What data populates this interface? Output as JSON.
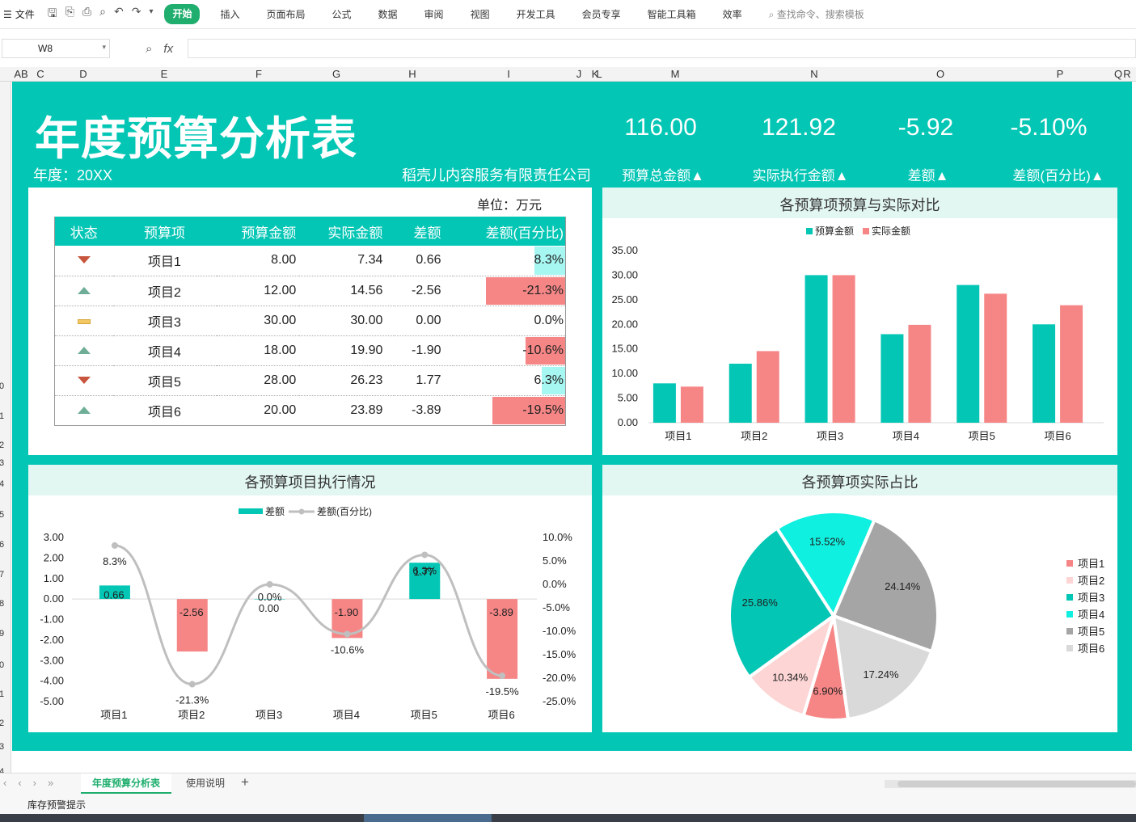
{
  "menu": {
    "file_label": "文件",
    "tabs": [
      "开始",
      "插入",
      "页面布局",
      "公式",
      "数据",
      "审阅",
      "视图",
      "开发工具",
      "会员专享",
      "智能工具箱",
      "效率"
    ],
    "search_placeholder": "查找命令、搜索模板"
  },
  "formula_bar": {
    "cell_ref": "W8",
    "fx_label": "fx",
    "value": ""
  },
  "columns": [
    "AB",
    "C",
    "D",
    "E",
    "F",
    "G",
    "H",
    "I",
    "J",
    "K",
    "L",
    "M",
    "N",
    "O",
    "P",
    "Q",
    "R"
  ],
  "row_numbers": [
    "0",
    "1",
    "2",
    "3",
    "4",
    "5",
    "6",
    "7",
    "8",
    "9",
    "0",
    "1",
    "2",
    "3",
    "4"
  ],
  "dashboard": {
    "title": "年度预算分析表",
    "year_label": "年度：20XX",
    "company": "稻壳儿内容服务有限责任公司",
    "kpis": [
      {
        "value": "116.00",
        "label": "预算总金额▲"
      },
      {
        "value": "121.92",
        "label": "实际执行金额▲"
      },
      {
        "value": "-5.92",
        "label": "差额▲"
      },
      {
        "value": "-5.10%",
        "label": "差额(百分比)▲"
      }
    ]
  },
  "budget_table": {
    "unit": "单位：万元",
    "headers": [
      "状态",
      "预算项",
      "预算金额",
      "实际金额",
      "差额",
      "差额(百分比)"
    ],
    "rows": [
      {
        "status": "down",
        "item": "项目1",
        "budget": "8.00",
        "actual": "7.34",
        "diff": "0.66",
        "pct": "8.3%",
        "pct_value": 0.083
      },
      {
        "status": "up",
        "item": "项目2",
        "budget": "12.00",
        "actual": "14.56",
        "diff": "-2.56",
        "pct": "-21.3%",
        "pct_value": -0.213
      },
      {
        "status": "flat",
        "item": "项目3",
        "budget": "30.00",
        "actual": "30.00",
        "diff": "0.00",
        "pct": "0.0%",
        "pct_value": 0
      },
      {
        "status": "up",
        "item": "项目4",
        "budget": "18.00",
        "actual": "19.90",
        "diff": "-1.90",
        "pct": "-10.6%",
        "pct_value": -0.106
      },
      {
        "status": "down",
        "item": "项目5",
        "budget": "28.00",
        "actual": "26.23",
        "diff": "1.77",
        "pct": "6.3%",
        "pct_value": 0.063
      },
      {
        "status": "up",
        "item": "项目6",
        "budget": "20.00",
        "actual": "23.89",
        "diff": "-3.89",
        "pct": "-19.5%",
        "pct_value": -0.195
      }
    ],
    "colors": {
      "positive": "#a6f6f1",
      "negative": "#f68686"
    }
  },
  "sheet_tabs": [
    "年度预算分析表",
    "使用说明"
  ],
  "status_text": "库存预警提示",
  "colors": {
    "teal": "#03c6b5",
    "salmon": "#f68686",
    "cyan": "#0ff0e0",
    "pink": "#fdd5d5",
    "gray": "#a5a5a5",
    "lightgray": "#d9d9d9"
  },
  "chart_data": [
    {
      "type": "bar",
      "title": "各预算项预算与实际对比",
      "categories": [
        "项目1",
        "项目2",
        "项目3",
        "项目4",
        "项目5",
        "项目6"
      ],
      "series": [
        {
          "name": "预算金额",
          "values": [
            8.0,
            12.0,
            30.0,
            18.0,
            28.0,
            20.0
          ],
          "color": "#03c6b5"
        },
        {
          "name": "实际金额",
          "values": [
            7.34,
            14.56,
            30.0,
            19.9,
            26.23,
            23.89
          ],
          "color": "#f68686"
        }
      ],
      "ylim": [
        0,
        35
      ],
      "yticks": [
        "0.00",
        "5.00",
        "10.00",
        "15.00",
        "20.00",
        "25.00",
        "30.00",
        "35.00"
      ],
      "legend": "top",
      "grid": false
    },
    {
      "type": "bar",
      "title": "各预算项目执行情况",
      "categories": [
        "项目1",
        "项目2",
        "项目3",
        "项目4",
        "项目5",
        "项目6"
      ],
      "series": [
        {
          "name": "差额",
          "values": [
            0.66,
            -2.56,
            0.0,
            -1.9,
            1.77,
            -3.89
          ],
          "labels": [
            "0.66",
            "-2.56",
            "0.00",
            "-1.90",
            "1.77",
            "-3.89"
          ]
        },
        {
          "name": "差额(百分比)",
          "type": "line",
          "values": [
            8.3,
            -21.3,
            0.0,
            -10.6,
            6.3,
            -19.5
          ],
          "labels": [
            "8.3%",
            "-21.3%",
            "0.0%",
            "-10.6%",
            "6.3%",
            "-19.5%"
          ],
          "color": "#bfbfbf"
        }
      ],
      "ylim": [
        -5,
        3
      ],
      "yticks": [
        "3.00",
        "2.00",
        "1.00",
        "0.00",
        "-1.00",
        "-2.00",
        "-3.00",
        "-4.00",
        "-5.00"
      ],
      "y2lim": [
        -25,
        10
      ],
      "y2ticks": [
        "10.0%",
        "5.0%",
        "0.0%",
        "-5.0%",
        "-10.0%",
        "-15.0%",
        "-20.0%",
        "-25.0%"
      ],
      "legend": "top"
    },
    {
      "type": "pie",
      "title": "各预算项实际占比",
      "labels": [
        "项目1",
        "项目2",
        "项目3",
        "项目4",
        "项目5",
        "项目6"
      ],
      "values": [
        6.9,
        10.34,
        25.86,
        15.52,
        24.14,
        17.24
      ],
      "value_labels": [
        "6.90%",
        "10.34%",
        "25.86%",
        "15.52%",
        "24.14%",
        "17.24%"
      ],
      "colors": [
        "#f68686",
        "#fdd5d5",
        "#03c6b5",
        "#0ff0e0",
        "#a5a5a5",
        "#d9d9d9"
      ],
      "legend": "right"
    }
  ]
}
